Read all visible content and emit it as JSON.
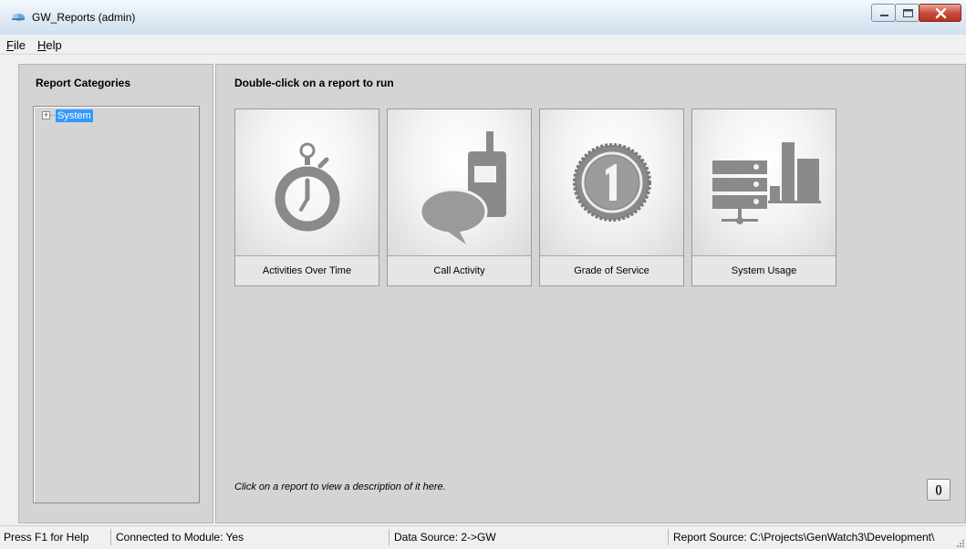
{
  "window": {
    "title": "GW_Reports (admin)"
  },
  "menu": {
    "file": {
      "accel": "F",
      "rest": "ile"
    },
    "help": {
      "accel": "H",
      "rest": "elp"
    }
  },
  "left_panel": {
    "title": "Report Categories",
    "tree": [
      {
        "label": "System",
        "expander": "+",
        "selected": true
      }
    ]
  },
  "right_panel": {
    "instruction": "Double-click on a report to run",
    "reports": [
      {
        "label": "Activities Over Time",
        "icon": "stopwatch-icon"
      },
      {
        "label": "Call Activity",
        "icon": "radio-chat-icon"
      },
      {
        "label": "Grade of Service",
        "icon": "badge-one-icon"
      },
      {
        "label": "System Usage",
        "icon": "server-chart-icon"
      }
    ],
    "description": "Click on a report to view a description of it here.",
    "refresh_label": "()"
  },
  "status": {
    "help": "Press F1 for Help",
    "connected": "Connected to Module: Yes",
    "data_source": "Data Source: 2->GW",
    "report_source": "Report Source: C:\\Projects\\GenWatch3\\Development\\"
  },
  "colors": {
    "selection": "#3399ff",
    "panel": "#d4d4d4",
    "close_button": "#c8483a"
  }
}
